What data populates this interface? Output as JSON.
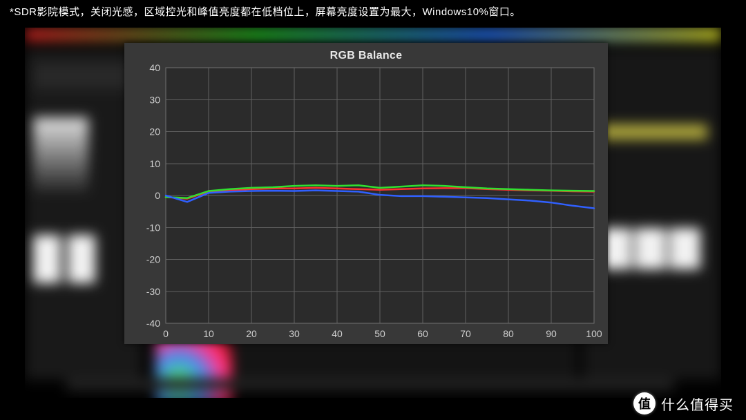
{
  "caption": "*SDR影院模式，关闭光感，区域控光和峰值亮度都在低档位上，屏幕亮度设置为最大，Windows10%窗口。",
  "watermark": {
    "badge": "值",
    "text": "什么值得买"
  },
  "chart_data": {
    "type": "line",
    "title": "RGB Balance",
    "xlabel": "",
    "ylabel": "",
    "xlim": [
      0,
      100
    ],
    "ylim": [
      -40,
      40
    ],
    "xticks": [
      0,
      10,
      20,
      30,
      40,
      50,
      60,
      70,
      80,
      90,
      100
    ],
    "yticks": [
      -40,
      -30,
      -20,
      -10,
      0,
      10,
      20,
      30,
      40
    ],
    "x": [
      0,
      5,
      10,
      15,
      20,
      25,
      30,
      35,
      40,
      45,
      50,
      55,
      60,
      65,
      70,
      75,
      80,
      85,
      90,
      95,
      100
    ],
    "series": [
      {
        "name": "Red",
        "color": "#ff3030",
        "values": [
          -0.5,
          -1.0,
          1.2,
          1.6,
          2.0,
          2.2,
          2.2,
          2.4,
          2.2,
          2.0,
          1.8,
          2.0,
          2.2,
          2.3,
          2.3,
          2.0,
          1.8,
          1.6,
          1.5,
          1.3,
          1.2
        ]
      },
      {
        "name": "Green",
        "color": "#30e030",
        "values": [
          -0.5,
          -0.8,
          1.4,
          2.0,
          2.4,
          2.6,
          3.0,
          3.2,
          3.0,
          3.2,
          2.4,
          2.8,
          3.2,
          3.0,
          2.6,
          2.2,
          2.0,
          1.8,
          1.6,
          1.5,
          1.4
        ]
      },
      {
        "name": "Blue",
        "color": "#3060ff",
        "values": [
          0.0,
          -2.0,
          0.8,
          1.2,
          1.4,
          1.5,
          1.4,
          1.6,
          1.4,
          1.2,
          0.2,
          -0.2,
          -0.2,
          -0.4,
          -0.6,
          -0.8,
          -1.2,
          -1.6,
          -2.2,
          -3.2,
          -4.0
        ]
      }
    ]
  }
}
